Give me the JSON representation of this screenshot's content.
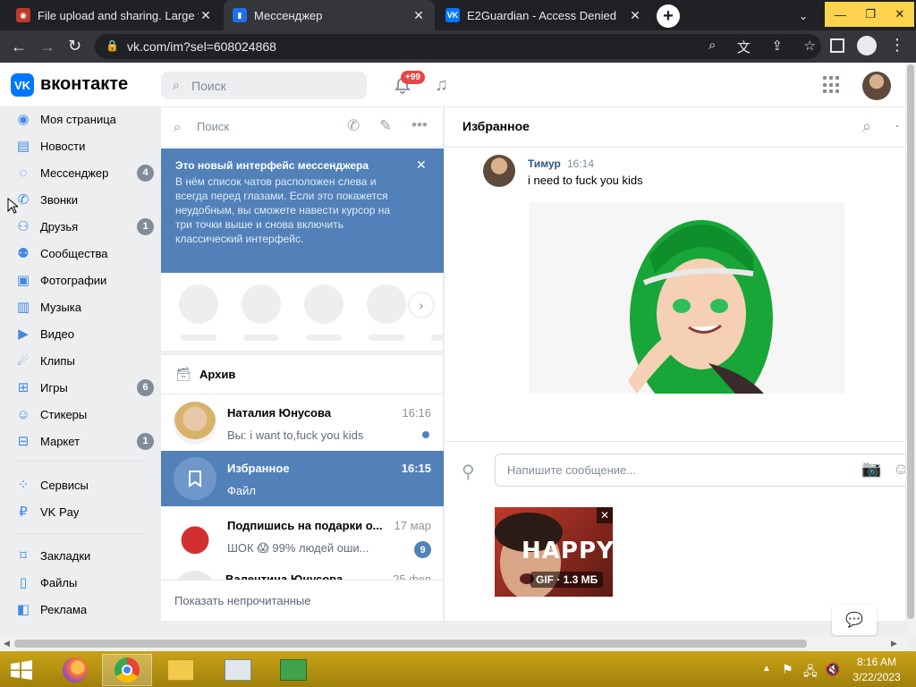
{
  "browser": {
    "tabs": [
      {
        "title": "File upload and sharing. Large file",
        "active": false
      },
      {
        "title": "Мессенджер",
        "active": true
      },
      {
        "title": "E2Guardian - Access Denied",
        "active": false
      }
    ],
    "url": "vk.com/im?sel=608024868"
  },
  "vk": {
    "logo_text": "вконтакте",
    "search_placeholder": "Поиск",
    "notif_badge": "+99",
    "nav": [
      {
        "label": "Моя страница",
        "icon": "user-icon",
        "count": ""
      },
      {
        "label": "Новости",
        "icon": "news-icon",
        "count": ""
      },
      {
        "label": "Мессенджер",
        "icon": "message-icon",
        "count": "4"
      },
      {
        "label": "Звонки",
        "icon": "phone-icon",
        "count": ""
      },
      {
        "label": "Друзья",
        "icon": "friends-icon",
        "count": "1"
      },
      {
        "label": "Сообщества",
        "icon": "groups-icon",
        "count": ""
      },
      {
        "label": "Фотографии",
        "icon": "photo-icon",
        "count": ""
      },
      {
        "label": "Музыка",
        "icon": "music-icon",
        "count": ""
      },
      {
        "label": "Видео",
        "icon": "video-icon",
        "count": ""
      },
      {
        "label": "Клипы",
        "icon": "clips-icon",
        "count": ""
      },
      {
        "label": "Игры",
        "icon": "games-icon",
        "count": "6"
      },
      {
        "label": "Стикеры",
        "icon": "stickers-icon",
        "count": ""
      },
      {
        "label": "Маркет",
        "icon": "market-icon",
        "count": "1"
      }
    ],
    "nav2": [
      {
        "label": "Сервисы",
        "icon": "services-icon"
      },
      {
        "label": "VK Pay",
        "icon": "vkpay-icon"
      }
    ],
    "nav3": [
      {
        "label": "Закладки",
        "icon": "bookmark-icon"
      },
      {
        "label": "Файлы",
        "icon": "files-icon"
      },
      {
        "label": "Реклама",
        "icon": "ads-icon"
      }
    ]
  },
  "chatlist": {
    "search_placeholder": "Поиск",
    "banner": {
      "title": "Это новый интерфейс мессенджера",
      "text": "В нём список чатов расположен слева и всегда перед глазами. Если это покажется неудобным, вы сможете навести курсор на три точки выше и снова включить классический интерфейс."
    },
    "archive_label": "Архив",
    "chats": [
      {
        "name": "Наталия Юнусова",
        "time": "16:16",
        "msg": "Вы: i want to,fuck you kids",
        "unread": "",
        "dot": true,
        "selected": false
      },
      {
        "name": "Избранное",
        "time": "16:15",
        "msg": "Файл",
        "unread": "",
        "dot": false,
        "selected": true
      },
      {
        "name": "Подпишись на подарки о...",
        "time": "17 мар",
        "msg": "ШОК 😱 99% людей оши...",
        "unread": "9",
        "dot": false,
        "selected": false
      },
      {
        "name": "Валентина Юнусова",
        "time": "25 фев",
        "msg": "",
        "unread": "",
        "dot": false,
        "selected": false
      }
    ],
    "show_unread": "Показать непрочитанные"
  },
  "conversation": {
    "title": "Избранное",
    "message": {
      "author": "Тимур",
      "time": "16:14",
      "text": "i need to fuck you kids"
    },
    "input_placeholder": "Напишите сообщение...",
    "attachment": {
      "title": "HAPPY",
      "meta": "GIF · 1.3 МБ"
    }
  },
  "taskbar": {
    "time": "8:16 AM",
    "date": "3/22/2023"
  }
}
